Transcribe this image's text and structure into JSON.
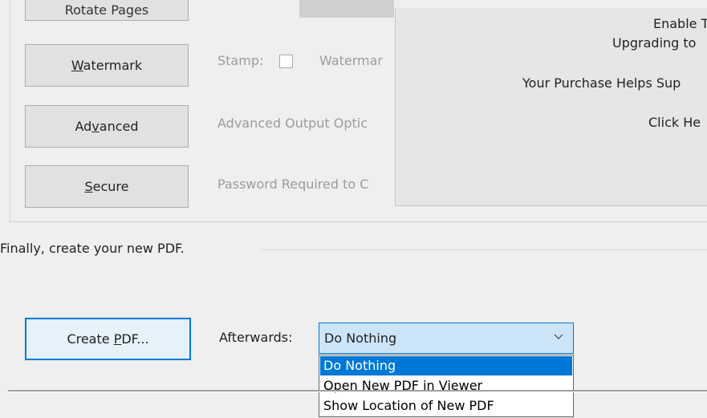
{
  "upper": {
    "rotate_button": {
      "label": "Rotate Pages"
    },
    "watermark_button": {
      "pre": "",
      "ul": "W",
      "post": "atermark"
    },
    "advanced_button": {
      "pre": "Ad",
      "ul": "v",
      "post": "anced"
    },
    "secure_button": {
      "pre": "",
      "ul": "S",
      "post": "ecure"
    },
    "stamp_label": "Stamp:",
    "watermark_text": "Watermar",
    "advanced_text": "Advanced Output Optic",
    "secure_text": "Password Required to C"
  },
  "upgrade": {
    "line1": "Enable Th",
    "line2": "Upgrading to",
    "line3": "Your Purchase Helps Sup",
    "line4": "Click He"
  },
  "finally": {
    "text": "Finally, create your new PDF."
  },
  "create_button": {
    "pre": "Create ",
    "ul": "P",
    "post": "DF..."
  },
  "afterwards": {
    "label": "Afterwards:",
    "selected": "Do Nothing",
    "options": [
      "Do Nothing",
      "Open New PDF in Viewer",
      "Show Location of New PDF"
    ]
  },
  "colors": {
    "accent": "#0078d7",
    "combo_bg": "#cce4f7",
    "button_bg": "#e1e1e1"
  },
  "icons": {
    "combo_arrow": "chevron-down-icon"
  }
}
